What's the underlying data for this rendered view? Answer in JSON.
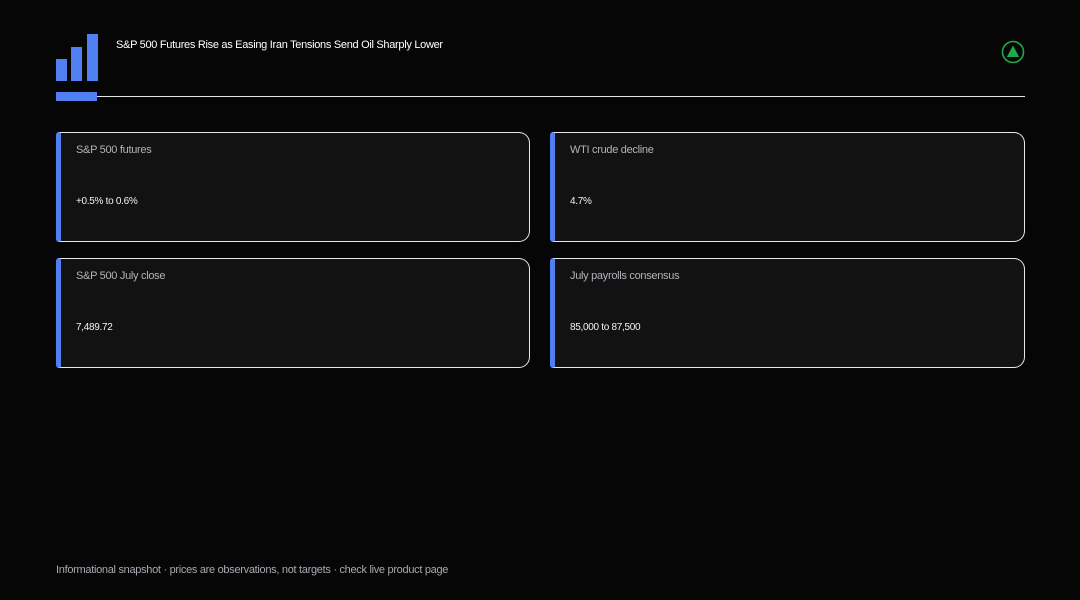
{
  "header": {
    "title": "S&P 500 Futures Rise as Easing Iran Tensions Send Oil Sharply Lower",
    "logo_icon": "bar-chart-logo-icon",
    "status_icon": "up-triangle-icon"
  },
  "colors": {
    "background": "#060606",
    "accent": "#4f7ff0",
    "card_background": "#121212",
    "card_border": "#e8e8e8",
    "status_green": "#1faa4b"
  },
  "cards": [
    {
      "label": "S&P 500 futures",
      "value": "+0.5% to 0.6%"
    },
    {
      "label": "WTI crude decline",
      "value": "4.7%"
    },
    {
      "label": "S&P 500 July close",
      "value": "7,489.72"
    },
    {
      "label": "July payrolls consensus",
      "value": "85,000 to 87,500"
    }
  ],
  "footer": {
    "note": "Informational snapshot · prices are observations, not targets · check live product page"
  }
}
